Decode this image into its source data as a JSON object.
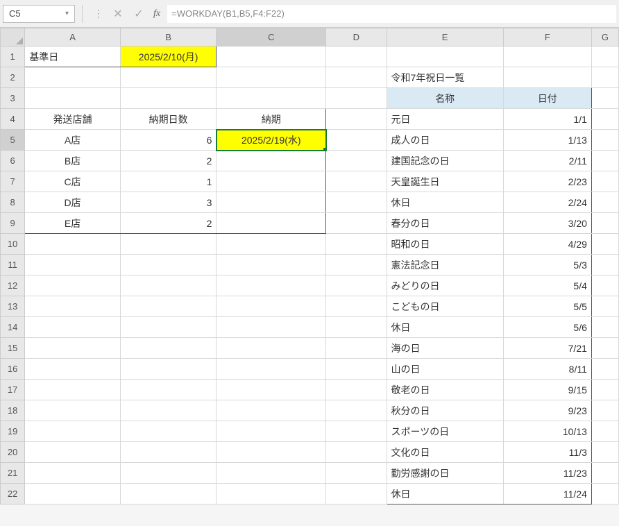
{
  "nameBox": "C5",
  "formulaBar": "=WORKDAY(B1,B5,F4:F22)",
  "columns": [
    "A",
    "B",
    "C",
    "D",
    "E",
    "F",
    "G"
  ],
  "rows": [
    "1",
    "2",
    "3",
    "4",
    "5",
    "6",
    "7",
    "8",
    "9",
    "10",
    "11",
    "12",
    "13",
    "14",
    "15",
    "16",
    "17",
    "18",
    "19",
    "20",
    "21",
    "22"
  ],
  "cells": {
    "A1": "基準日",
    "B1": "2025/2/10(月)",
    "E2": "令和7年祝日一覧",
    "E3": "名称",
    "F3": "日付",
    "A4": "発送店舗",
    "B4": "納期日数",
    "C4": "納期",
    "E4": "元日",
    "F4": "1/1",
    "A5": "A店",
    "B5": "6",
    "C5": "2025/2/19(水)",
    "E5": "成人の日",
    "F5": "1/13",
    "A6": "B店",
    "B6": "2",
    "E6": "建国記念の日",
    "F6": "2/11",
    "A7": "C店",
    "B7": "1",
    "E7": "天皇誕生日",
    "F7": "2/23",
    "A8": "D店",
    "B8": "3",
    "E8": "休日",
    "F8": "2/24",
    "A9": "E店",
    "B9": "2",
    "E9": "春分の日",
    "F9": "3/20",
    "E10": "昭和の日",
    "F10": "4/29",
    "E11": "憲法記念日",
    "F11": "5/3",
    "E12": "みどりの日",
    "F12": "5/4",
    "E13": "こどもの日",
    "F13": "5/5",
    "E14": "休日",
    "F14": "5/6",
    "E15": "海の日",
    "F15": "7/21",
    "E16": "山の日",
    "F16": "8/11",
    "E17": "敬老の日",
    "F17": "9/15",
    "E18": "秋分の日",
    "F18": "9/23",
    "E19": "スポーツの日",
    "F19": "10/13",
    "E20": "文化の日",
    "F20": "11/3",
    "E21": "勤労感謝の日",
    "F21": "11/23",
    "E22": "休日",
    "F22": "11/24"
  }
}
